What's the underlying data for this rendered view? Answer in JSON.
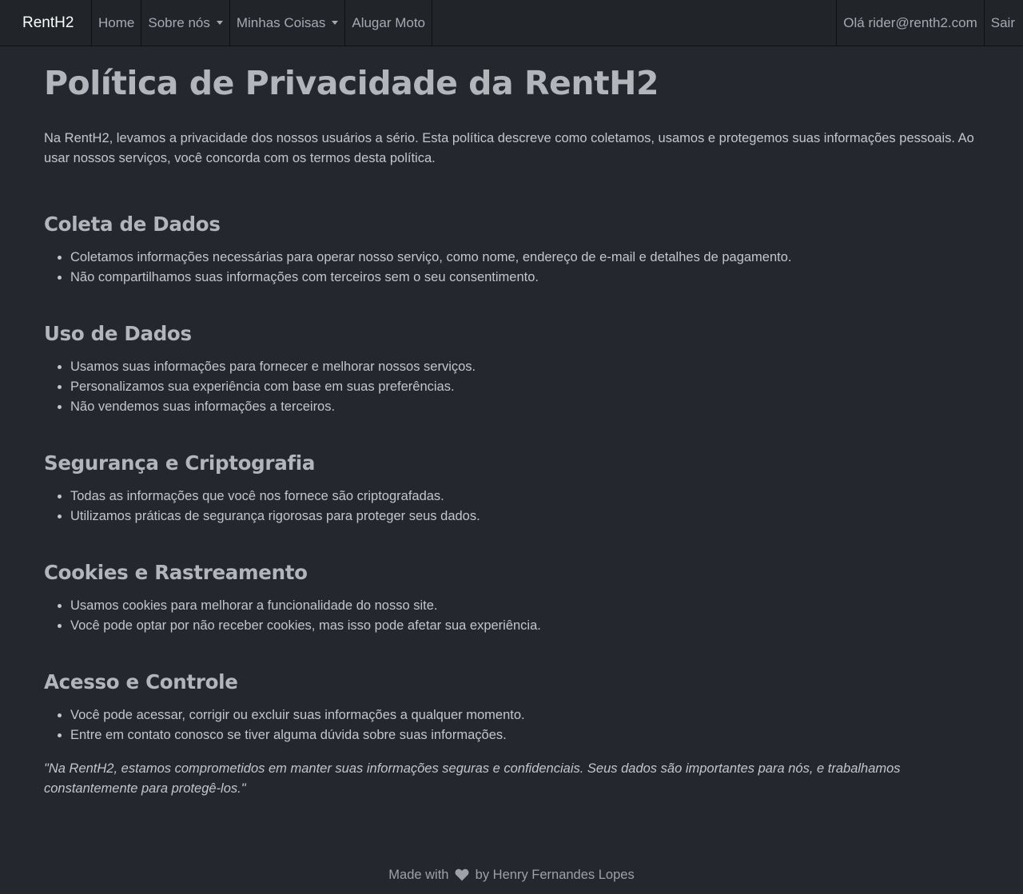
{
  "navbar": {
    "brand": "RentH2",
    "links": {
      "home": "Home",
      "about": "Sobre nós",
      "my_stuff": "Minhas Coisas",
      "rent": "Alugar Moto"
    },
    "greeting": "Olá rider@renth2.com",
    "logout": "Sair"
  },
  "page": {
    "title": "Política de Privacidade da RentH2",
    "intro": "Na RentH2, levamos a privacidade dos nossos usuários a sério. Esta política descreve como coletamos, usamos e protegemos suas informações pessoais. Ao usar nossos serviços, você concorda com os termos desta política.",
    "sections": [
      {
        "heading": "Coleta de Dados",
        "items": [
          "Coletamos informações necessárias para operar nosso serviço, como nome, endereço de e-mail e detalhes de pagamento.",
          "Não compartilhamos suas informações com terceiros sem o seu consentimento."
        ]
      },
      {
        "heading": "Uso de Dados",
        "items": [
          "Usamos suas informações para fornecer e melhorar nossos serviços.",
          "Personalizamos sua experiência com base em suas preferências.",
          "Não vendemos suas informações a terceiros."
        ]
      },
      {
        "heading": "Segurança e Criptografia",
        "items": [
          "Todas as informações que você nos fornece são criptografadas.",
          "Utilizamos práticas de segurança rigorosas para proteger seus dados."
        ]
      },
      {
        "heading": "Cookies e Rastreamento",
        "items": [
          "Usamos cookies para melhorar a funcionalidade do nosso site.",
          "Você pode optar por não receber cookies, mas isso pode afetar sua experiência."
        ]
      },
      {
        "heading": "Acesso e Controle",
        "items": [
          "Você pode acessar, corrigir ou excluir suas informações a qualquer momento.",
          "Entre em contato conosco se tiver alguma dúvida sobre suas informações."
        ]
      }
    ],
    "quote": "\"Na RentH2, estamos comprometidos em manter suas informações seguras e confidenciais. Seus dados são importantes para nós, e trabalhamos constantemente para protegê-los.\""
  },
  "footer": {
    "made_with": "Made with",
    "by": "by Henry Fernandes Lopes",
    "heart_icon": "heart-icon"
  },
  "colors": {
    "background": "#24272d",
    "navbar": "#212529",
    "heading": "#b2b5ba",
    "text": "#c3c6cb"
  }
}
